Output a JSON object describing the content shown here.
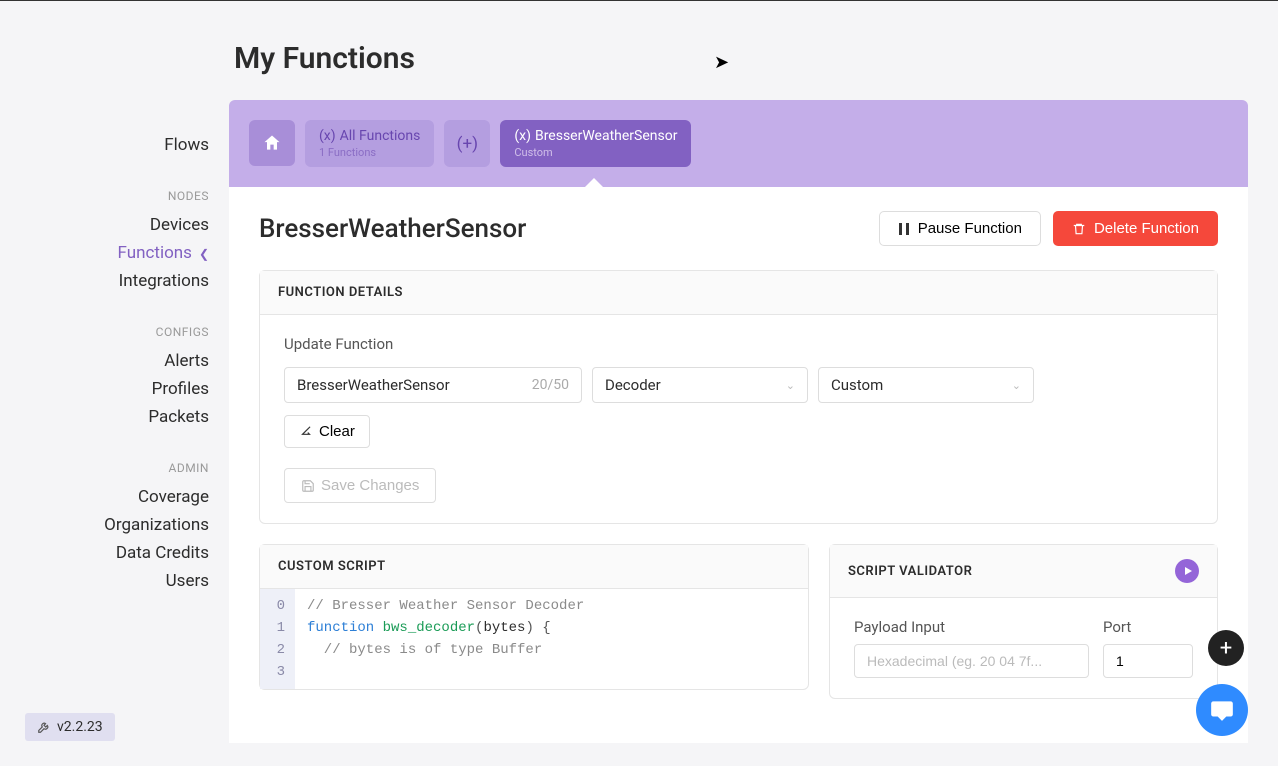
{
  "page": {
    "title": "My Functions"
  },
  "sidebar": {
    "flows": "Flows",
    "sections": {
      "nodes": {
        "label": "NODES",
        "devices": "Devices",
        "functions": "Functions",
        "integrations": "Integrations"
      },
      "configs": {
        "label": "CONFIGS",
        "alerts": "Alerts",
        "profiles": "Profiles",
        "packets": "Packets"
      },
      "admin": {
        "label": "ADMIN",
        "coverage": "Coverage",
        "organizations": "Organizations",
        "datacredits": "Data Credits",
        "users": "Users"
      }
    },
    "version": "v2.2.23"
  },
  "tabs": {
    "all": {
      "title": "All Functions",
      "sub": "1 Functions"
    },
    "plus": "(+)",
    "active": {
      "title": "BresserWeatherSensor",
      "sub": "Custom"
    }
  },
  "header": {
    "name": "BresserWeatherSensor",
    "pause": "Pause Function",
    "delete": "Delete Function"
  },
  "details": {
    "card_title": "FUNCTION DETAILS",
    "update_label": "Update Function",
    "name_value": "BresserWeatherSensor",
    "name_counter": "20/50",
    "type_value": "Decoder",
    "format_value": "Custom",
    "clear": "Clear",
    "save": "Save Changes"
  },
  "script": {
    "card_title": "CUSTOM SCRIPT",
    "lines": [
      "0",
      "1",
      "2",
      "3"
    ],
    "code": {
      "l0_comment": "// Bresser Weather Sensor Decoder",
      "l1_kw": "function",
      "l1_name": " bws_decoder",
      "l1_args": "bytes",
      "l2_comment": "  // bytes is of type Buffer"
    }
  },
  "validator": {
    "card_title": "SCRIPT VALIDATOR",
    "payload_label": "Payload Input",
    "payload_placeholder": "Hexadecimal (eg. 20 04 7f...",
    "port_label": "Port",
    "port_value": "1"
  }
}
